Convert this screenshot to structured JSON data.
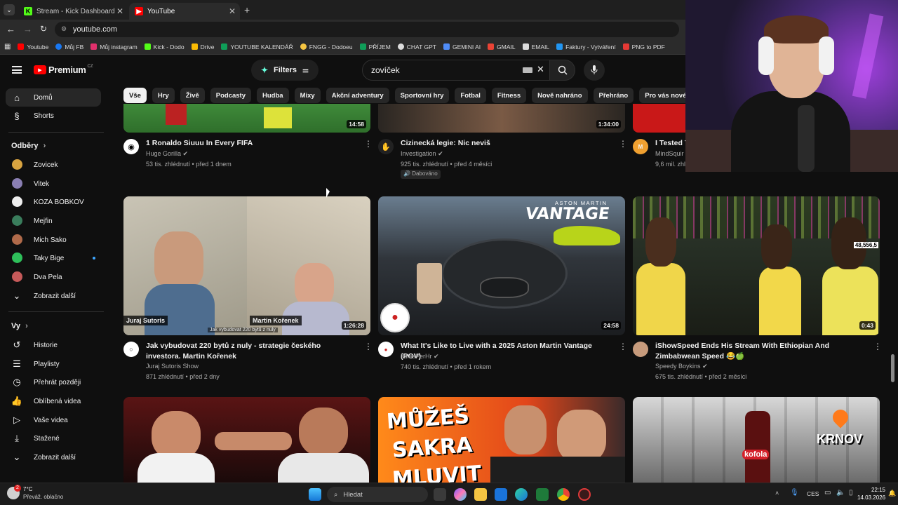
{
  "browser": {
    "tabs": [
      {
        "label": "Stream - Kick Dashboard"
      },
      {
        "label": "YouTube"
      }
    ],
    "url": "youtube.com",
    "bookmarks": [
      "Youtube",
      "Můj FB",
      "Můj instagram",
      "Kick - Dodo",
      "Drive",
      "YOUTUBE KALENDÁŘ",
      "FNGG - Dodoeu",
      "PŘÍJEM",
      "CHAT GPT",
      "GEMINI AI",
      "GMAIL",
      "EMAIL",
      "Faktury - Vytváření",
      "PNG to PDF"
    ]
  },
  "header": {
    "logo": "Premium",
    "logo_sup": "CZ",
    "filters_label": "Filters",
    "search_value": "zovíček"
  },
  "chips": [
    "Vše",
    "Hry",
    "Živě",
    "Podcasty",
    "Hudba",
    "Mixy",
    "Akční adventury",
    "Sportovní hry",
    "Fotbal",
    "Fitness",
    "Nově nahráno",
    "Přehráno",
    "Pro vás nové"
  ],
  "sidebar": {
    "main": [
      {
        "label": "Domů"
      },
      {
        "label": "Shorts"
      }
    ],
    "subs_heading": "Odběry",
    "subs": [
      {
        "label": "Zovicek"
      },
      {
        "label": "Vitek"
      },
      {
        "label": "KOZA BOBKOV"
      },
      {
        "label": "Mejfin"
      },
      {
        "label": "Mich Sako"
      },
      {
        "label": "Taky Bige"
      },
      {
        "label": "Dva Pela"
      },
      {
        "label": "Zobrazit další"
      }
    ],
    "you_heading": "Vy",
    "you": [
      {
        "label": "Historie"
      },
      {
        "label": "Playlisty"
      },
      {
        "label": "Přehrát později"
      },
      {
        "label": "Oblíbená videa"
      },
      {
        "label": "Vaše videa"
      },
      {
        "label": "Stažené"
      },
      {
        "label": "Zobrazit další"
      }
    ]
  },
  "videos_row1": [
    {
      "title": "1 Ronaldo Siuuu In Every FIFA",
      "channel": "Huge Gorilla",
      "meta": "53 tis. zhlédnutí • před 1 dnem",
      "duration": "14:58"
    },
    {
      "title": "Cizinecká legie: Nic neviš",
      "channel": "Investigation",
      "meta": "925 tis. zhlédnutí • před 4 měsíci",
      "badge": "Dabováno",
      "duration": "1:34:00"
    },
    {
      "title": "I Tested T",
      "channel": "MindSquir",
      "meta": "9,6 mil. zhl"
    }
  ],
  "videos_row2": [
    {
      "title": "Jak vybudovat 220 bytů z nuly  - strategie českého investora. Martin Kořenek",
      "channel": "Juraj Sutoris Show",
      "meta": "871 zhlédnutí • před 2 dny",
      "duration": "1:26:28",
      "overlay_left": "Juraj Sutoris",
      "overlay_right": "Martin Kořenek",
      "caption": "Jak vybudovat 220 bytů z nuly"
    },
    {
      "title": "What It's Like to Live with a 2025 Aston Martin Vantage (POV)",
      "channel": "MilesPerHr",
      "meta": "740 tis. zhlédnutí • před 1 rokem",
      "duration": "24:58",
      "brand": "ASTON MARTIN",
      "model": "VANTAGE"
    },
    {
      "title": "iShowSpeed Ends His Stream With Ethiopian And Zimbabwean Speed 😂🍏",
      "channel": "Speedy Boykins",
      "meta": "675 tis. zhlédnutí • před 2 měsíci",
      "duration": "0:43",
      "viewers": "48,556,5"
    }
  ],
  "videos_row3": [
    {
      "thumb_text": ""
    },
    {
      "thumb_text_1": "MŮŽEŠ",
      "thumb_text_2": "SAKRA",
      "thumb_text_3": "MLUVIT"
    },
    {
      "thumb_text": "KRNOV",
      "brand": "kofola"
    }
  ],
  "taskbar": {
    "temp": "7°C",
    "weather": "Převáž. oblačno",
    "search": "Hledat",
    "lang": "CES",
    "time": "22:15",
    "date": "14.03.2026",
    "weather_badge": "2"
  },
  "colors": {
    "accent": "#ff0000",
    "bg": "#0f0f0f",
    "chip": "#272727"
  }
}
